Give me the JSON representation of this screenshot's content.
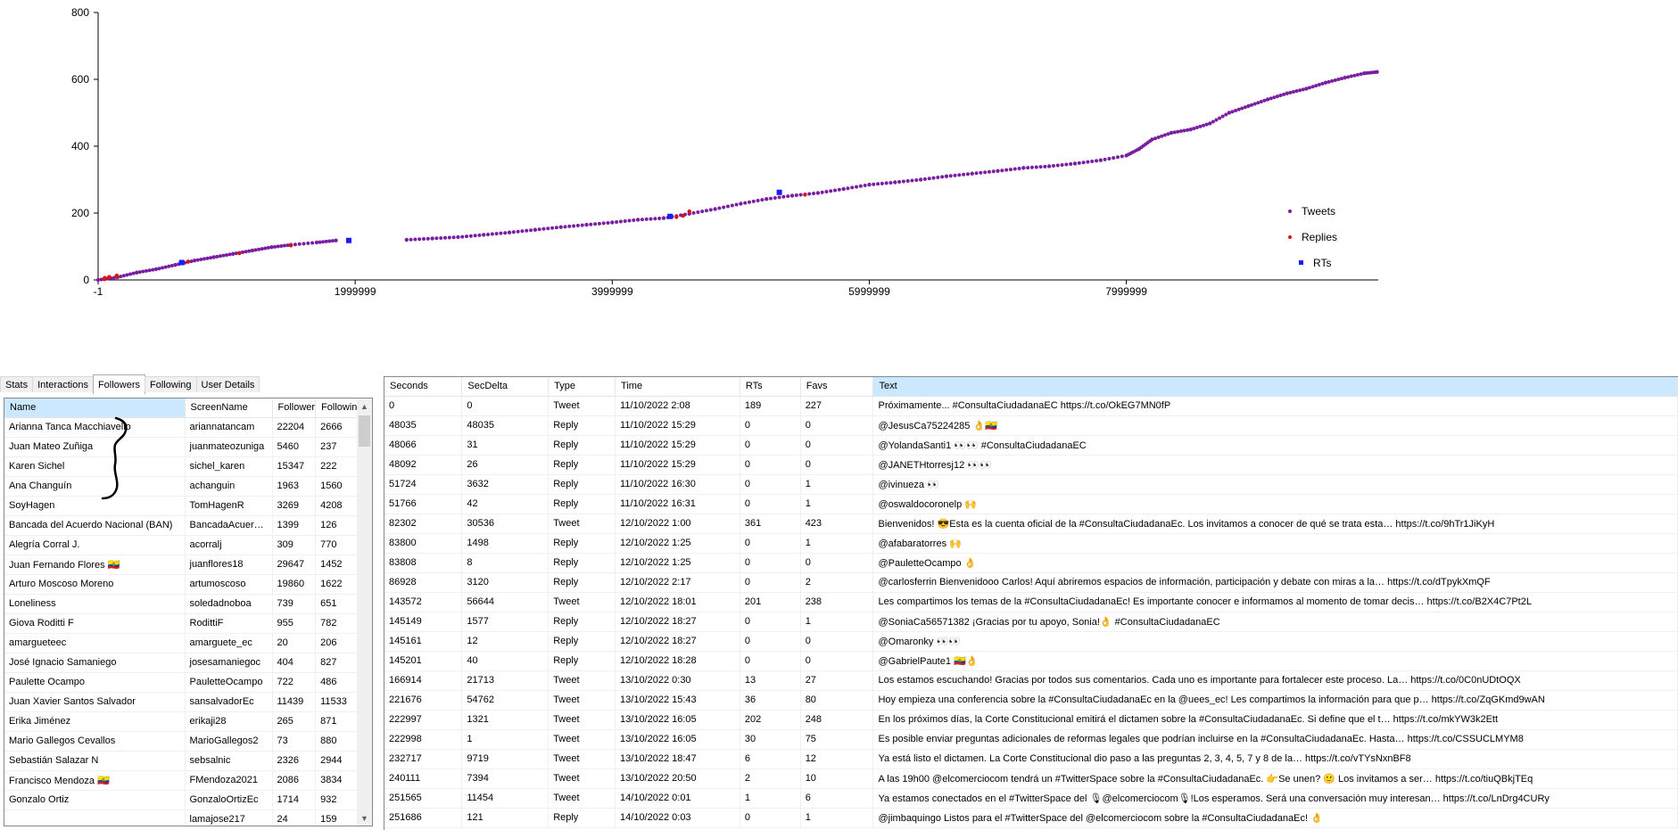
{
  "chart_data": {
    "type": "scatter",
    "xlim": [
      -1,
      9960000
    ],
    "ylim": [
      0,
      800
    ],
    "x_ticks": [
      -1,
      1999999,
      3999999,
      5999999,
      7999999
    ],
    "x_tick_labels": [
      "-1",
      "1999999",
      "3999999",
      "5999999",
      "7999999"
    ],
    "y_ticks": [
      0,
      200,
      400,
      600,
      800
    ],
    "y_tick_labels": [
      "0",
      "200",
      "400",
      "600",
      "800"
    ],
    "legend_position": "right",
    "series": [
      {
        "name": "Tweets",
        "color": "#7b1fa2",
        "marker": "circle",
        "points": [
          [
            0,
            0
          ],
          [
            150000,
            8
          ],
          [
            300000,
            22
          ],
          [
            450000,
            32
          ],
          [
            600000,
            45
          ],
          [
            750000,
            58
          ],
          [
            900000,
            68
          ],
          [
            1050000,
            78
          ],
          [
            1200000,
            88
          ],
          [
            1350000,
            98
          ],
          [
            1500000,
            105
          ],
          [
            1700000,
            112
          ],
          [
            1850000,
            118
          ],
          [
            2400000,
            120
          ],
          [
            2600000,
            124
          ],
          [
            2800000,
            128
          ],
          [
            3000000,
            135
          ],
          [
            3200000,
            142
          ],
          [
            3400000,
            150
          ],
          [
            3600000,
            158
          ],
          [
            3800000,
            165
          ],
          [
            4000000,
            172
          ],
          [
            4200000,
            180
          ],
          [
            4400000,
            185
          ],
          [
            4600000,
            198
          ],
          [
            4800000,
            212
          ],
          [
            5000000,
            228
          ],
          [
            5200000,
            242
          ],
          [
            5400000,
            252
          ],
          [
            5600000,
            260
          ],
          [
            5800000,
            272
          ],
          [
            6000000,
            285
          ],
          [
            6200000,
            292
          ],
          [
            6400000,
            300
          ],
          [
            6600000,
            310
          ],
          [
            6800000,
            318
          ],
          [
            7000000,
            326
          ],
          [
            7200000,
            335
          ],
          [
            7400000,
            340
          ],
          [
            7600000,
            348
          ],
          [
            7800000,
            358
          ],
          [
            8000000,
            372
          ],
          [
            8100000,
            392
          ],
          [
            8200000,
            420
          ],
          [
            8350000,
            440
          ],
          [
            8500000,
            450
          ],
          [
            8650000,
            468
          ],
          [
            8800000,
            500
          ],
          [
            8950000,
            520
          ],
          [
            9100000,
            540
          ],
          [
            9250000,
            558
          ],
          [
            9400000,
            572
          ],
          [
            9550000,
            590
          ],
          [
            9700000,
            605
          ],
          [
            9850000,
            618
          ],
          [
            9950000,
            622
          ]
        ]
      },
      {
        "name": "Replies",
        "color": "#e01010",
        "marker": "circle",
        "points": [
          [
            48035,
            2
          ],
          [
            48066,
            3
          ],
          [
            48092,
            4
          ],
          [
            51724,
            5
          ],
          [
            51766,
            6
          ],
          [
            83800,
            7
          ],
          [
            83808,
            8
          ],
          [
            86928,
            9
          ],
          [
            143572,
            10
          ],
          [
            145149,
            11
          ],
          [
            145161,
            12
          ],
          [
            145201,
            13
          ],
          [
            700000,
            55
          ],
          [
            1100000,
            80
          ],
          [
            1500000,
            103
          ],
          [
            4500000,
            188
          ],
          [
            4550000,
            192
          ],
          [
            4600000,
            205
          ],
          [
            5500000,
            255
          ]
        ]
      },
      {
        "name": "RTs",
        "color": "#1a1aff",
        "marker": "square",
        "points": [
          [
            650000,
            52
          ],
          [
            1950000,
            118
          ],
          [
            4450000,
            190
          ],
          [
            5300000,
            262
          ]
        ]
      }
    ]
  },
  "tabs": [
    "Stats",
    "Interactions",
    "Followers",
    "Following",
    "User Details"
  ],
  "active_tab": "Followers",
  "followers_table": {
    "columns": [
      "Name",
      "ScreenName",
      "Follower",
      "Following"
    ],
    "rows": [
      [
        "Arianna Tanca Macchiavello",
        "ariannatancam",
        "22204",
        "2666"
      ],
      [
        "Juan Mateo Zuñiga",
        "juanmateozuniga",
        "5460",
        "237"
      ],
      [
        "Karen Sichel",
        "sichel_karen",
        "15347",
        "222"
      ],
      [
        "Ana Changuín",
        "achanguin",
        "1963",
        "1560"
      ],
      [
        "SoyHagen",
        "TomHagenR",
        "3269",
        "4208"
      ],
      [
        "Bancada del Acuerdo Nacional (BAN)",
        "BancadaAcuer…",
        "1399",
        "126"
      ],
      [
        "Alegría Corral J.",
        "acorralj",
        "309",
        "770"
      ],
      [
        "Juan Fernando Flores 🇪🇨",
        "juanflores18",
        "29647",
        "1452"
      ],
      [
        "Arturo Moscoso Moreno",
        "artumoscoso",
        "19860",
        "1622"
      ],
      [
        "Loneliness",
        "soledadnoboa",
        "739",
        "651"
      ],
      [
        "Giova Roditti F",
        "RodittiF",
        "955",
        "782"
      ],
      [
        "amargueteec",
        "amarguete_ec",
        "20",
        "206"
      ],
      [
        "José Ignacio Samaniego",
        "josesamaniegoc",
        "404",
        "827"
      ],
      [
        "Paulette Ocampo",
        "PauletteOcampo",
        "722",
        "486"
      ],
      [
        "Juan Xavier Santos Salvador",
        "sansalvadorEc",
        "11439",
        "11533"
      ],
      [
        "Erika Jiménez",
        "erikaji28",
        "265",
        "871"
      ],
      [
        "Mario Gallegos Cevallos",
        "MarioGallegos2",
        "73",
        "880"
      ],
      [
        "Sebastián Salazar N",
        "sebsalnic",
        "2326",
        "2944"
      ],
      [
        "Francisco Mendoza 🇪🇨",
        "FMendoza2021",
        "2086",
        "3834"
      ],
      [
        "Gonzalo Ortiz",
        "GonzaloOrtizEc",
        "1714",
        "932"
      ],
      [
        "",
        "lamajose217",
        "24",
        "159"
      ]
    ]
  },
  "tweets_table": {
    "columns": [
      "Seconds",
      "SecDelta",
      "Type",
      "Time",
      "RTs",
      "Favs",
      "Text"
    ],
    "rows": [
      [
        "0",
        "0",
        "Tweet",
        "11/10/2022 2:08",
        "189",
        "227",
        "Próximamente... #ConsultaCiudadanaEC https://t.co/OkEG7MN0fP"
      ],
      [
        "48035",
        "48035",
        "Reply",
        "11/10/2022 15:29",
        "0",
        "0",
        "@JesusCa75224285 👌🇪🇨"
      ],
      [
        "48066",
        "31",
        "Reply",
        "11/10/2022 15:29",
        "0",
        "0",
        "@YolandaSanti1 👀👀 #ConsultaCiudadanaEC"
      ],
      [
        "48092",
        "26",
        "Reply",
        "11/10/2022 15:29",
        "0",
        "0",
        "@JANETHtorresj12 👀👀"
      ],
      [
        "51724",
        "3632",
        "Reply",
        "11/10/2022 16:30",
        "0",
        "1",
        "@ivinueza 👀"
      ],
      [
        "51766",
        "42",
        "Reply",
        "11/10/2022 16:31",
        "0",
        "1",
        "@oswaldocoronelp 🙌"
      ],
      [
        "82302",
        "30536",
        "Tweet",
        "12/10/2022 1:00",
        "361",
        "423",
        "Bienvenidos! 😎Esta es la cuenta oficial de la #ConsultaCiudadanaEc. Los invitamos a conocer de qué se trata esta… https://t.co/9hTr1JiKyH"
      ],
      [
        "83800",
        "1498",
        "Reply",
        "12/10/2022 1:25",
        "0",
        "1",
        "@afabaratorres 🙌"
      ],
      [
        "83808",
        "8",
        "Reply",
        "12/10/2022 1:25",
        "0",
        "0",
        "@PauletteOcampo 👌"
      ],
      [
        "86928",
        "3120",
        "Reply",
        "12/10/2022 2:17",
        "0",
        "2",
        "@carlosferrin Bienvenidooo Carlos! Aquí abriremos espacios de información, participación y debate con miras a la… https://t.co/dTpykXmQF"
      ],
      [
        "143572",
        "56644",
        "Tweet",
        "12/10/2022 18:01",
        "201",
        "238",
        "Les compartimos los temas de la #ConsultaCiudadanaEc! Es importante conocer e informamos al momento de tomar decis… https://t.co/B2X4C7Pt2L"
      ],
      [
        "145149",
        "1577",
        "Reply",
        "12/10/2022 18:27",
        "0",
        "1",
        "@SoniaCa56571382 ¡Gracias por tu apoyo, Sonia!👌 #ConsultaCiudadanaEC"
      ],
      [
        "145161",
        "12",
        "Reply",
        "12/10/2022 18:27",
        "0",
        "0",
        "@Omaronky 👀👀"
      ],
      [
        "145201",
        "40",
        "Reply",
        "12/10/2022 18:28",
        "0",
        "0",
        "@GabrielPaute1 🇪🇨👌"
      ],
      [
        "166914",
        "21713",
        "Tweet",
        "13/10/2022 0:30",
        "13",
        "27",
        "Los estamos escuchando! Gracias por todos sus comentarios. Cada uno es importante para fortalecer este proceso. La… https://t.co/0C0nUDtOQX"
      ],
      [
        "221676",
        "54762",
        "Tweet",
        "13/10/2022 15:43",
        "36",
        "80",
        "Hoy empieza una conferencia sobre la #ConsultaCiudadanaEc en la @uees_ec! Les compartimos la información para que p… https://t.co/ZqGKmd9wAN"
      ],
      [
        "222997",
        "1321",
        "Tweet",
        "13/10/2022 16:05",
        "202",
        "248",
        "En los próximos días, la Corte Constitucional emitirá el dictamen sobre la #ConsultaCiudadanaEc. Si define que el t… https://t.co/mkYW3k2Ett"
      ],
      [
        "222998",
        "1",
        "Tweet",
        "13/10/2022 16:05",
        "30",
        "75",
        "Es posible enviar preguntas adicionales de reformas legales que podrían incluirse en la #ConsultaCiudadanaEc. Hasta… https://t.co/CSSUCLMYM8"
      ],
      [
        "232717",
        "9719",
        "Tweet",
        "13/10/2022 18:47",
        "6",
        "12",
        "Ya está listo el dictamen. La Corte Constitucional dio paso a las preguntas 2, 3, 4, 5, 7 y 8 de la… https://t.co/vTYsNxnBF8"
      ],
      [
        "240111",
        "7394",
        "Tweet",
        "13/10/2022 20:50",
        "2",
        "10",
        "A las 19h00 @elcomerciocom tendrá un #TwitterSpace sobre la #ConsultaCiudadanaEc. 👉Se unen? 🙂 Los invitamos a ser… https://t.co/tiuQBkjTEq"
      ],
      [
        "251565",
        "11454",
        "Tweet",
        "14/10/2022 0:01",
        "1",
        "6",
        "Ya estamos conectados en el #TwitterSpace del 🎙@elcomerciocom🎙!Los esperamos. Será una conversación muy interesan… https://t.co/LnDrg4CURy"
      ],
      [
        "251686",
        "121",
        "Reply",
        "14/10/2022 0:03",
        "0",
        "1",
        "@jimbaquingo Listos para el #TwitterSpace del @elcomerciocom sobre la #ConsultaCiudadanaEc! 👌"
      ]
    ]
  }
}
